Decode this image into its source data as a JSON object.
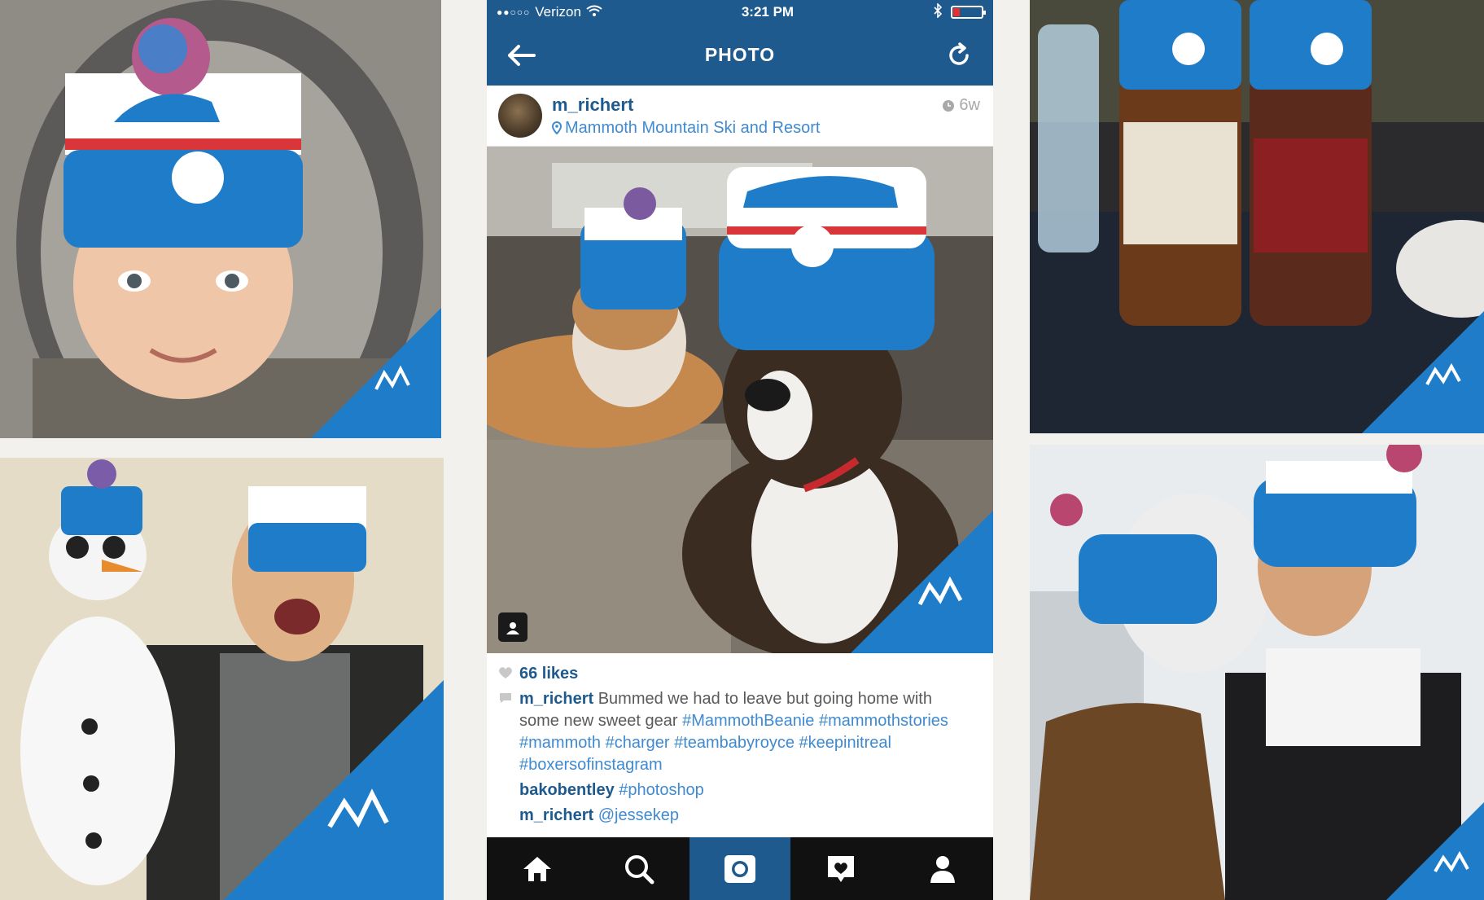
{
  "status_bar": {
    "carrier": "Verizon",
    "signal_dots": "●●○○○",
    "time": "3:21 PM"
  },
  "nav": {
    "title": "PHOTO",
    "back_icon": "arrow-left-icon",
    "refresh_icon": "refresh-icon"
  },
  "post": {
    "username": "m_richert",
    "location": "Mammoth Mountain Ski and Resort",
    "age": "6w",
    "likes": "66 likes",
    "caption_user": "m_richert",
    "caption_text": "Bummed we had to leave but going home with some new sweet gear",
    "caption_tags": [
      "#MammothBeanie",
      "#mammothstories",
      "#mammoth",
      "#charger",
      "#teambabyroyce",
      "#keepinitreal",
      "#boxersofinstagram"
    ],
    "comments": [
      {
        "user": "bakobentley",
        "text": "#photoshop"
      },
      {
        "user": "m_richert",
        "text": "@jessekep"
      }
    ]
  },
  "tabs": [
    {
      "icon": "home-icon",
      "active": false
    },
    {
      "icon": "search-icon",
      "active": false
    },
    {
      "icon": "camera-icon",
      "active": true
    },
    {
      "icon": "activity-heart-icon",
      "active": false
    },
    {
      "icon": "profile-icon",
      "active": false
    }
  ],
  "brand": {
    "name": "Mammoth",
    "blue": "#1f7cc8",
    "nav_blue": "#1f5a8e"
  },
  "photos": [
    "baby-in-beanie",
    "man-with-snowman",
    "beer-bottles-in-beanies",
    "couple-kissing-in-beanies"
  ]
}
